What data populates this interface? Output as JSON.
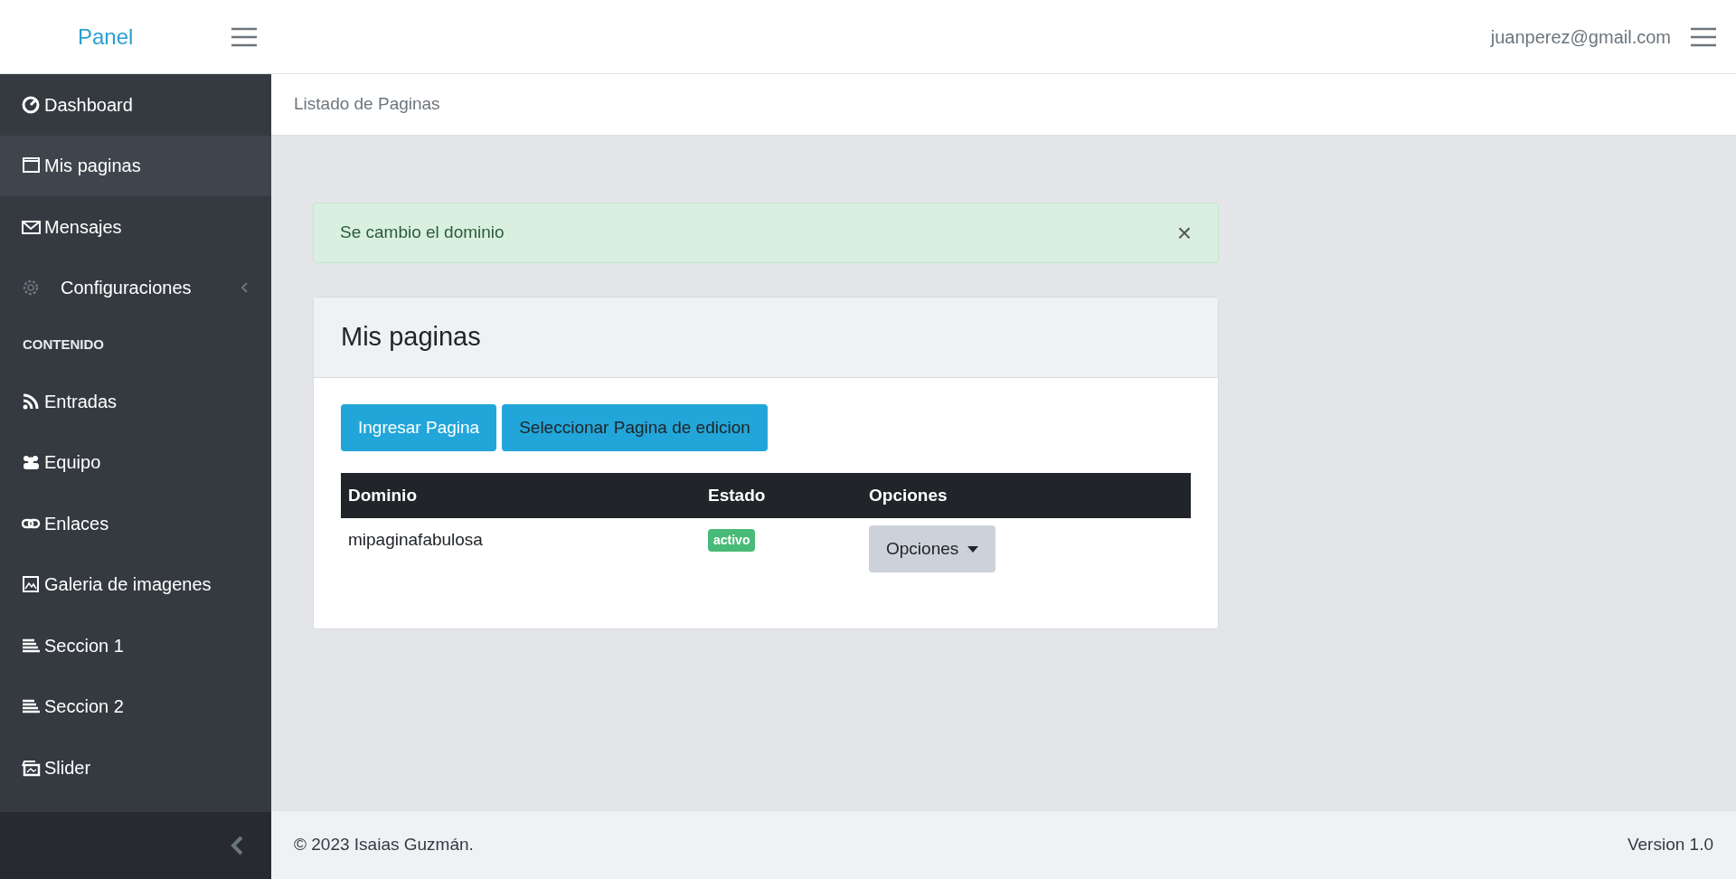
{
  "header": {
    "brand": "Panel",
    "user": "juanperez@gmail.com"
  },
  "sidebar": {
    "items": [
      {
        "kind": "link",
        "label": "Dashboard",
        "selected": false
      },
      {
        "kind": "link",
        "label": "Mis paginas",
        "selected": true
      },
      {
        "kind": "link",
        "label": "Mensajes",
        "selected": false
      },
      {
        "kind": "submenu",
        "label": "Configuraciones",
        "selected": false,
        "expanded": false
      },
      {
        "kind": "header",
        "label": "CONTENIDO"
      },
      {
        "kind": "link",
        "label": "Entradas",
        "selected": false
      },
      {
        "kind": "link",
        "label": "Equipo",
        "selected": false
      },
      {
        "kind": "link",
        "label": "Enlaces",
        "selected": false
      },
      {
        "kind": "link",
        "label": "Galeria de imagenes",
        "selected": false
      },
      {
        "kind": "link",
        "label": "Seccion 1",
        "selected": false
      },
      {
        "kind": "link",
        "label": "Seccion 2",
        "selected": false
      },
      {
        "kind": "link",
        "label": "Slider",
        "selected": false
      }
    ]
  },
  "breadcrumb": "Listado de Paginas",
  "alert": {
    "message": "Se cambio el dominio",
    "close": "×"
  },
  "card": {
    "title": "Mis paginas",
    "buttons": [
      "Ingresar Pagina",
      "Seleccionar Pagina de edicion"
    ],
    "table": {
      "columns": [
        "Dominio",
        "Estado",
        "Opciones"
      ],
      "rows": [
        {
          "domain": "mipaginafabulosa",
          "status": "activo",
          "color": "#48bb78",
          "options": "Opciones"
        }
      ]
    }
  },
  "footer": {
    "copyright": "© 2023 Isaias Guzmán.",
    "version": "Version 1.0"
  }
}
